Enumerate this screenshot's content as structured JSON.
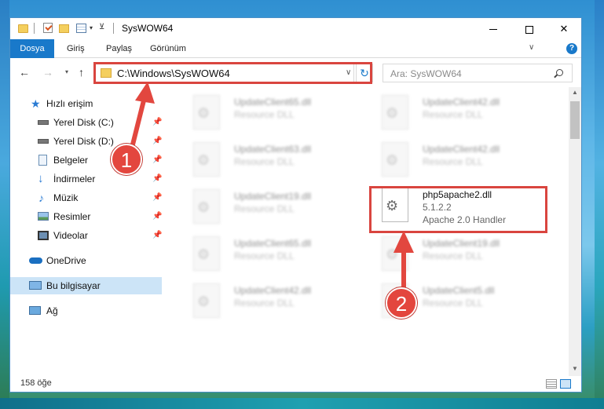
{
  "window": {
    "title": "SysWOW64"
  },
  "ribbon": {
    "file_tab": "Dosya",
    "tabs": [
      "Giriş",
      "Paylaş",
      "Görünüm"
    ]
  },
  "address": {
    "path": "C:\\Windows\\SysWOW64",
    "search_placeholder": "Ara: SysWOW64"
  },
  "sidebar": {
    "quick_access": "Hızlı erişim",
    "items": [
      {
        "label": "Yerel Disk (C:)",
        "icon": "drive-icon",
        "pinned": true
      },
      {
        "label": "Yerel Disk (D:)",
        "icon": "drive-icon",
        "pinned": true
      },
      {
        "label": "Belgeler",
        "icon": "documents-icon",
        "pinned": true
      },
      {
        "label": "İndirmeler",
        "icon": "download-icon",
        "pinned": true
      },
      {
        "label": "Müzik",
        "icon": "music-icon",
        "pinned": true
      },
      {
        "label": "Resimler",
        "icon": "pictures-icon",
        "pinned": true
      },
      {
        "label": "Videolar",
        "icon": "videos-icon",
        "pinned": true
      }
    ],
    "onedrive": "OneDrive",
    "this_pc": "Bu bilgisayar",
    "network": "Ağ"
  },
  "files": [
    {
      "name": "UpdateClient65.dll",
      "desc": "Resource DLL"
    },
    {
      "name": "UpdateClient42.dll",
      "desc": "Resource DLL"
    },
    {
      "name": "UpdateClient63.dll",
      "desc": "Resource DLL"
    },
    {
      "name": "UpdateClient42.dll",
      "desc": "Resource DLL"
    },
    {
      "name": "UpdateClient19.dll",
      "desc": "Resource DLL"
    },
    {
      "name": "UpdateClient65.dll",
      "desc": "Resource DLL"
    },
    {
      "name": "UpdateClient19.dll",
      "desc": "Resource DLL"
    },
    {
      "name": "UpdateClient42.dll",
      "desc": "Resource DLL"
    },
    {
      "name": "UpdateClient5.dll",
      "desc": "Resource DLL"
    }
  ],
  "target_file": {
    "name": "php5apache2.dll",
    "version": "5.1.2.2",
    "desc": "Apache 2.0 Handler"
  },
  "status": {
    "item_count": "158 öğe"
  },
  "annotations": {
    "badge1": "1",
    "badge2": "2",
    "color": "#e3463e"
  }
}
